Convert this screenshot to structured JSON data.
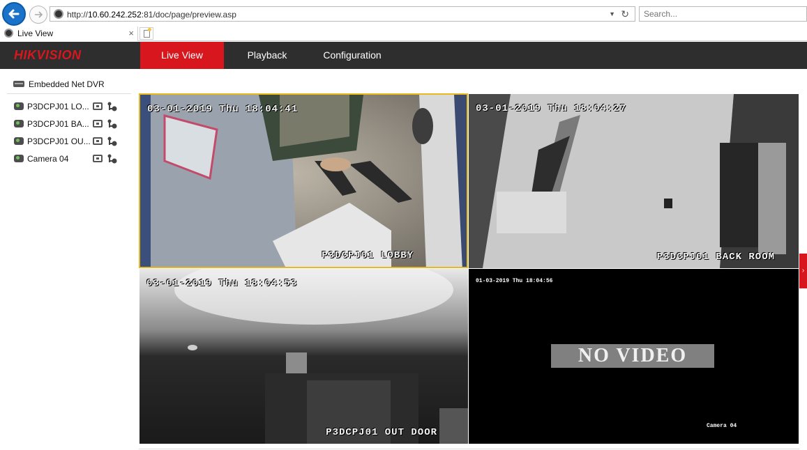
{
  "browser": {
    "url_prefix": "http://",
    "url_host": "10.60.242.252",
    "url_rest": ":81/doc/page/preview.asp",
    "search_placeholder": "Search...",
    "tab_title": "Live View",
    "tab_close": "×"
  },
  "app": {
    "logo_hik": "HIK",
    "logo_vision": "VISION",
    "nav": [
      {
        "label": "Live View",
        "active": true
      },
      {
        "label": "Playback",
        "active": false
      },
      {
        "label": "Configuration",
        "active": false
      }
    ]
  },
  "device_panel": {
    "title": "Embedded Net DVR",
    "channels": [
      {
        "label": "P3DCPJ01 LO..."
      },
      {
        "label": "P3DCPJ01 BA..."
      },
      {
        "label": "P3DCPJ01 OU..."
      },
      {
        "label": "Camera 04"
      }
    ]
  },
  "tiles": [
    {
      "timestamp": "03-01-2019 Thu 18:04:41",
      "name": "P3DCPJ01 LOBBY"
    },
    {
      "timestamp": "03-01-2019 Thu 18:04:27",
      "name": "P3DCPJ01 BACK ROOM"
    },
    {
      "timestamp": "03-01-2019 Thu 18:04:53",
      "name": "P3DCPJ01 OUT DOOR"
    },
    {
      "timestamp": "01-03-2019 Thu 18:04:56",
      "name": "Camera 04",
      "status": "NO VIDEO"
    }
  ],
  "side_toggle": "›",
  "colors": {
    "brand_red": "#d7161e",
    "header_dark": "#2e2e2e",
    "selected_tile_border": "#e8b820"
  }
}
